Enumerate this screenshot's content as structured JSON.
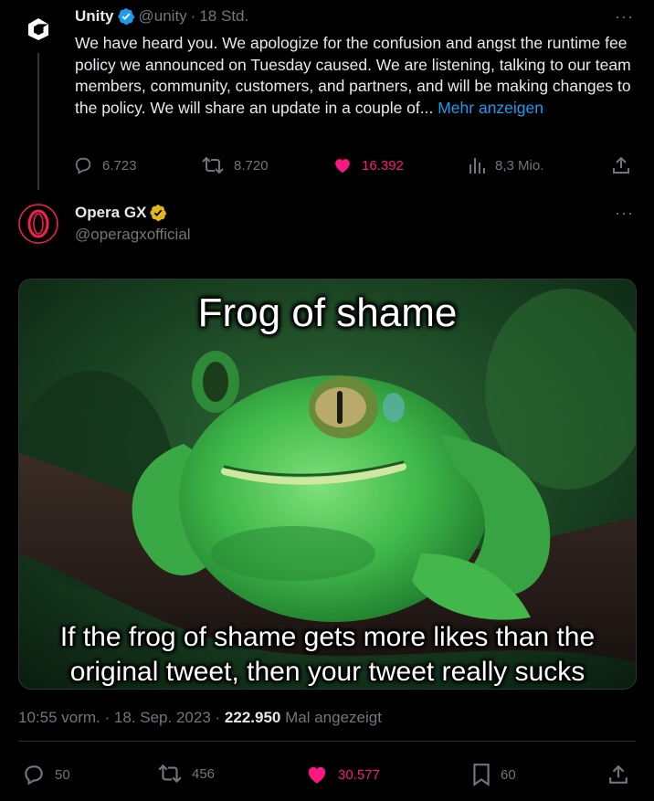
{
  "quoted_tweet": {
    "name": "Unity",
    "handle": "@unity",
    "separator": "·",
    "time": "18 Std.",
    "more": "···",
    "text": "We have heard you. We apologize for the confusion and angst the runtime fee policy we announced on Tuesday caused. We are listening, talking to our team members, community, customers, and partners, and will be making changes to the policy. We will share an update in a couple of...",
    "show_more": "Mehr anzeigen",
    "replies": "6.723",
    "retweets": "8.720",
    "likes": "16.392",
    "views": "8,3 Mio."
  },
  "main_tweet": {
    "name": "Opera GX",
    "handle": "@operagxofficial",
    "more": "···",
    "meme_top": "Frog of shame",
    "meme_bottom": "If the frog of shame gets more likes than the original tweet, then your tweet really sucks",
    "timestamp_time": "10:55 vorm.",
    "timestamp_date": "18. Sep. 2023",
    "separator": "·",
    "views_count": "222.950",
    "views_label": "Mal angezeigt",
    "replies": "50",
    "retweets": "456",
    "likes": "30.577",
    "bookmarks": "60"
  },
  "colors": {
    "like": "#f91880",
    "link": "#1d9bf0",
    "muted": "#71767b",
    "verified_blue": "#1d9bf0",
    "verified_gold": "#e2b719",
    "opera_red": "#fa1e4e"
  },
  "icons": [
    "unity-logo-icon",
    "verified-badge-icon",
    "gold-verified-badge-icon",
    "reply-icon",
    "retweet-icon",
    "heart-icon",
    "views-icon",
    "share-icon",
    "bookmark-icon"
  ]
}
